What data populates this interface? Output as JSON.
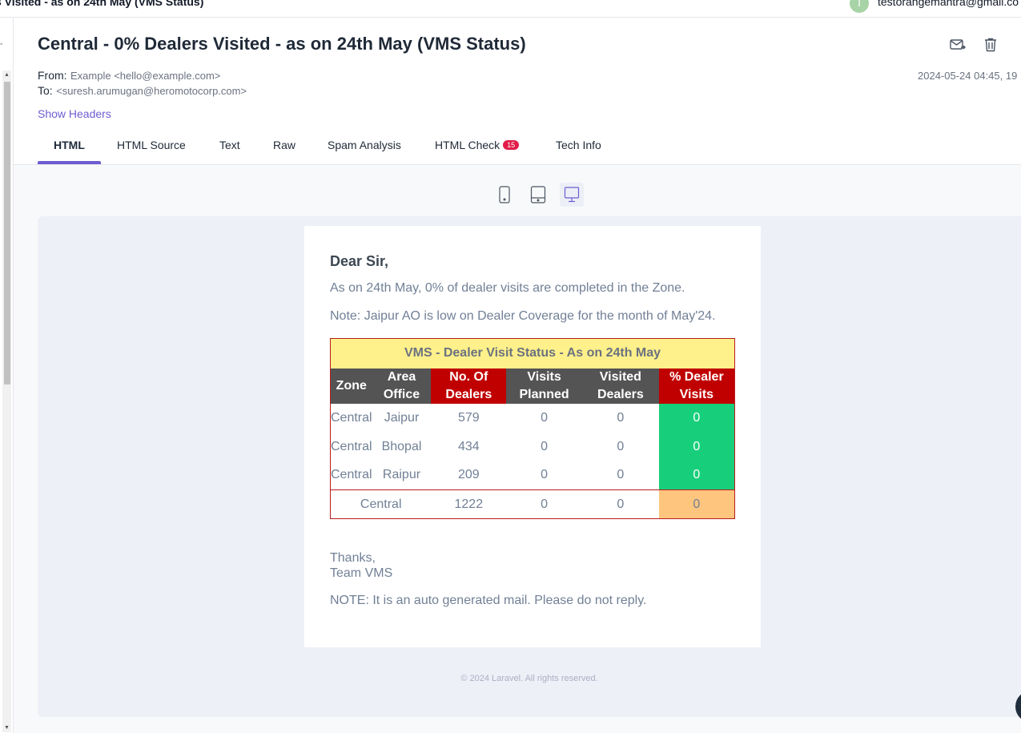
{
  "window": {
    "title": "s Visited - as on 24th May (VMS Status)",
    "account_initial": "T",
    "account": "testorangemantra@gmail.co"
  },
  "message": {
    "subject": "Central - 0% Dealers Visited - as on 24th May (VMS Status)",
    "from_label": "From:",
    "from_value": "Example <hello@example.com>",
    "to_label": "To:",
    "to_value": "<suresh.arumugan@heromotocorp.com>",
    "date": "2024-05-24 04:45, 19",
    "show_headers": "Show Headers",
    "icons": [
      "forward-icon",
      "trash-icon"
    ]
  },
  "tabs": [
    {
      "label": "HTML",
      "active": true
    },
    {
      "label": "HTML Source"
    },
    {
      "label": "Text"
    },
    {
      "label": "Raw"
    },
    {
      "label": "Spam Analysis"
    },
    {
      "label": "HTML Check",
      "badge": "15"
    },
    {
      "label": "Tech Info"
    }
  ],
  "devices": [
    "mobile-icon",
    "tablet-icon",
    "desktop-icon"
  ],
  "email": {
    "greeting": "Dear Sir,",
    "line1": "As on 24th May, 0% of dealer visits are completed in the Zone.",
    "line2": "Note: Jaipur AO is low on Dealer Coverage for the month of May'24.",
    "table": {
      "caption": "VMS - Dealer Visit Status - As on 24th May",
      "headers": [
        "Zone",
        "Area Office",
        "No. Of Dealers",
        "Visits Planned",
        "Visited Dealers",
        "% Dealer Visits"
      ],
      "rows": [
        [
          "Central",
          "Jaipur",
          "579",
          "0",
          "0",
          "0"
        ],
        [
          "Central",
          "Bhopal",
          "434",
          "0",
          "0",
          "0"
        ],
        [
          "Central",
          "Raipur",
          "209",
          "0",
          "0",
          "0"
        ]
      ],
      "total": [
        "Central",
        "1222",
        "0",
        "0",
        "0"
      ]
    },
    "thanks": "Thanks,",
    "team": "Team VMS",
    "note": "NOTE: It is an auto generated mail. Please do not reply.",
    "footer": "© 2024 Laravel. All rights reserved."
  },
  "colors": {
    "accent": "#6d5dd3",
    "badge": "#e11d48",
    "table_caption": "#fef08a",
    "header_dark": "#545454",
    "header_red": "#c00000",
    "status_green": "#17cf7a",
    "status_orange": "#fdc57e"
  }
}
